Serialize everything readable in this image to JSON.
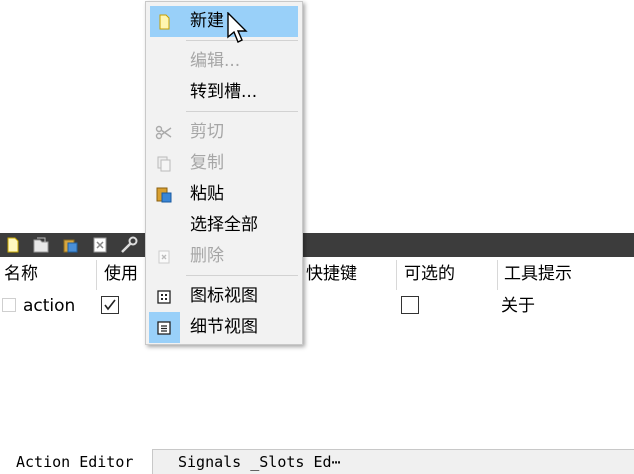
{
  "toolbar": {
    "icons": [
      "new-icon",
      "open-icon",
      "copy-paste-icon",
      "delete-icon",
      "wrench-icon"
    ]
  },
  "table": {
    "headers": [
      "名称",
      "使用",
      "快捷键",
      "可选的",
      "工具提示"
    ],
    "row": {
      "name": "action",
      "used": true,
      "checkable": false,
      "tooltip": "关于"
    }
  },
  "context_menu": {
    "items": [
      {
        "label": "新建",
        "icon": "new-doc-icon",
        "enabled": true,
        "highlighted": true
      },
      {
        "label": "编辑...",
        "enabled": false
      },
      {
        "label": "转到槽...",
        "enabled": true
      },
      {
        "label": "剪切",
        "icon": "scissors-icon",
        "enabled": false
      },
      {
        "label": "复制",
        "icon": "copy-icon",
        "enabled": false
      },
      {
        "label": "粘贴",
        "icon": "paste-icon",
        "enabled": true
      },
      {
        "label": "选择全部",
        "enabled": true
      },
      {
        "label": "删除",
        "icon": "delete-icon",
        "enabled": false
      },
      {
        "label": "图标视图",
        "icon": "icon-view-icon",
        "enabled": true
      },
      {
        "label": "细节视图",
        "icon": "detail-view-icon",
        "enabled": true,
        "checked": true
      }
    ]
  },
  "tabs": {
    "active": "Action Editor",
    "inactive": "Signals _Slots Ed⋯"
  },
  "colors": {
    "highlight": "#99d0f9",
    "toolbar_bg": "#3c3c3c",
    "menu_bg": "#f2f2f2",
    "disabled_text": "#a6a6a6"
  }
}
